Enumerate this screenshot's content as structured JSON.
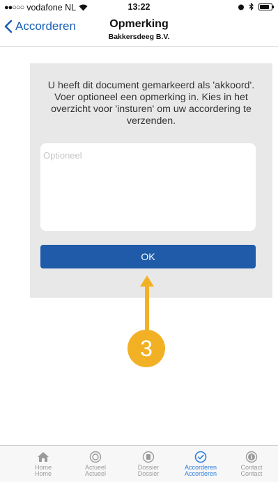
{
  "status_bar": {
    "signal": "●●○○○",
    "carrier": "vodafone NL",
    "time": "13:22"
  },
  "nav": {
    "back_label": "Accorderen",
    "title": "Opmerking",
    "subtitle": "Bakkersdeeg B.V."
  },
  "panel": {
    "message": "U heeft dit document gemarkeerd als 'akkoord'. Voer optioneel een opmerking in. Kies in het overzicht voor 'insturen' om uw accordering te verzenden.",
    "input_placeholder": "Optioneel",
    "input_value": "",
    "ok_label": "OK"
  },
  "annotation": {
    "step_number": "3",
    "color": "#f2b124"
  },
  "tabbar": {
    "active_color": "#2a7ee0",
    "items": [
      {
        "icon": "home-icon",
        "label": "Home",
        "label2": "Home"
      },
      {
        "icon": "actueel-icon",
        "label": "Actueel",
        "label2": "Actueel"
      },
      {
        "icon": "dossier-icon",
        "label": "Dossier",
        "label2": "Dossier"
      },
      {
        "icon": "check-circle-icon",
        "label": "Accorderen",
        "label2": "Accorderen"
      },
      {
        "icon": "info-icon",
        "label": "Contact",
        "label2": "Contact"
      }
    ]
  }
}
